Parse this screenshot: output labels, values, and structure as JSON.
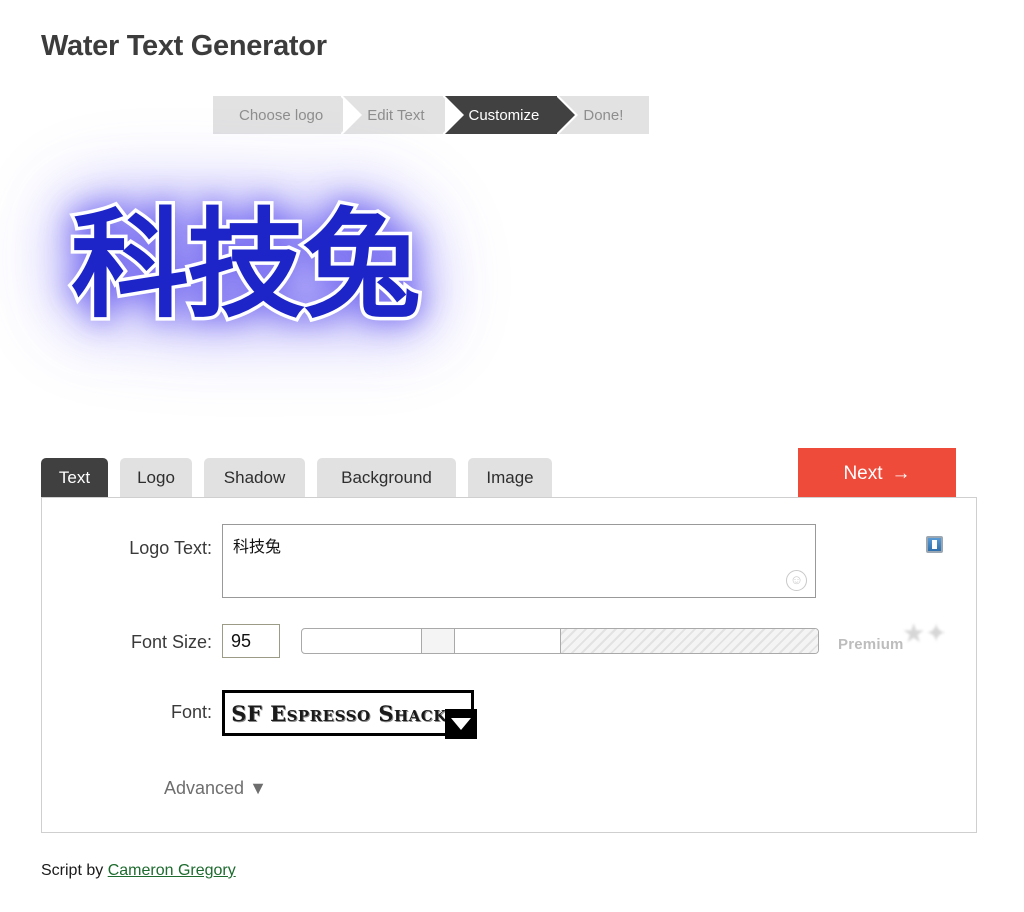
{
  "page": {
    "title": "Water Text Generator"
  },
  "steps": [
    {
      "label": "Choose logo",
      "active": false
    },
    {
      "label": "Edit Text",
      "active": false
    },
    {
      "label": "Customize",
      "active": true
    },
    {
      "label": "Done!",
      "active": false
    }
  ],
  "preview": {
    "text": "科技兔",
    "text_color": "#1e25c8",
    "outline_color": "#ffffff",
    "glow_color": "#8a80f5"
  },
  "tabs": [
    {
      "label": "Text",
      "active": true
    },
    {
      "label": "Logo",
      "active": false
    },
    {
      "label": "Shadow",
      "active": false
    },
    {
      "label": "Background",
      "active": false
    },
    {
      "label": "Image",
      "active": false
    }
  ],
  "next_button": {
    "label": "Next",
    "arrow": "→",
    "color": "#ef4b3a"
  },
  "form": {
    "logo_text": {
      "label": "Logo Text:",
      "value": "科技兔",
      "placeholder": "",
      "smiley_icon": "☺"
    },
    "save_icon": "save-icon",
    "font_size": {
      "label": "Font Size:",
      "value": "95",
      "slider_position_percent": 23,
      "premium_region_start_percent": 50
    },
    "premium": {
      "label": "Premium",
      "stars": "★"
    },
    "font": {
      "label": "Font:",
      "value": "SF Espresso Shack"
    },
    "advanced": {
      "label": "Advanced",
      "caret": "▼"
    }
  },
  "footer": {
    "prefix": "Script by ",
    "link_text": "Cameron Gregory"
  }
}
